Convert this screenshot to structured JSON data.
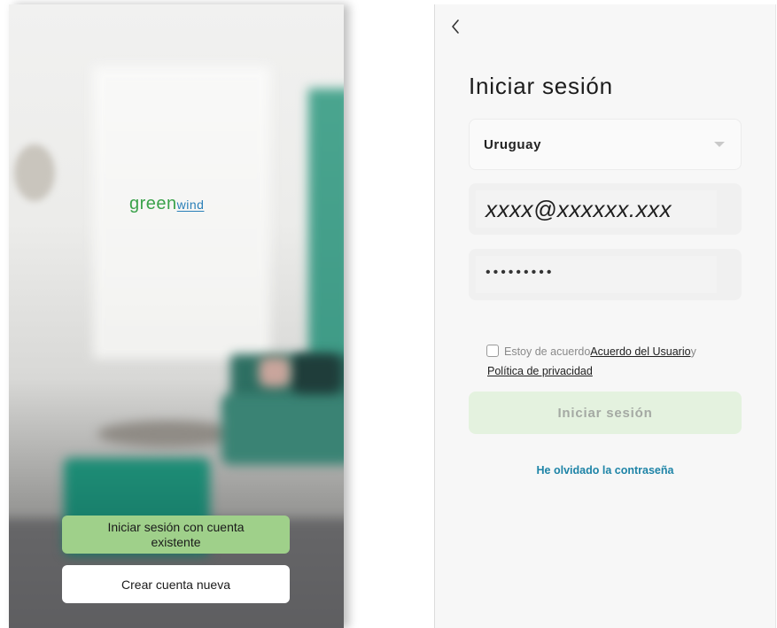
{
  "welcome_screen": {
    "logo": {
      "green_part": "green",
      "wind_part": "wind"
    },
    "existing_account_button": "Iniciar sesión con cuenta existente",
    "create_account_button": "Crear cuenta nueva",
    "colors": {
      "logo_green": "#3aa24a",
      "logo_blue": "#2a7fb8",
      "primary_button": "#9fd08a",
      "secondary_button": "#ffffff"
    }
  },
  "login_screen": {
    "back_icon": "chevron-left-icon",
    "title": "Iniciar sesión",
    "country": {
      "value": "Uruguay",
      "icon": "caret-down-icon"
    },
    "email": {
      "value": "xxxx@xxxxxx.xxx"
    },
    "password": {
      "value": "•••••••••"
    },
    "agreement": {
      "checked": false,
      "prefix": "Estoy de acuerdo",
      "user_agreement_link": "Acuerdo del Usuario",
      "connector": "y",
      "privacy_link": "Política de privacidad"
    },
    "login_button": "Iniciar sesión",
    "forgot_password_link": "He olvidado la contraseña",
    "colors": {
      "login_button_bg": "#e4f2df",
      "login_button_text": "#a4a9a3",
      "link": "#1e84a7"
    }
  }
}
